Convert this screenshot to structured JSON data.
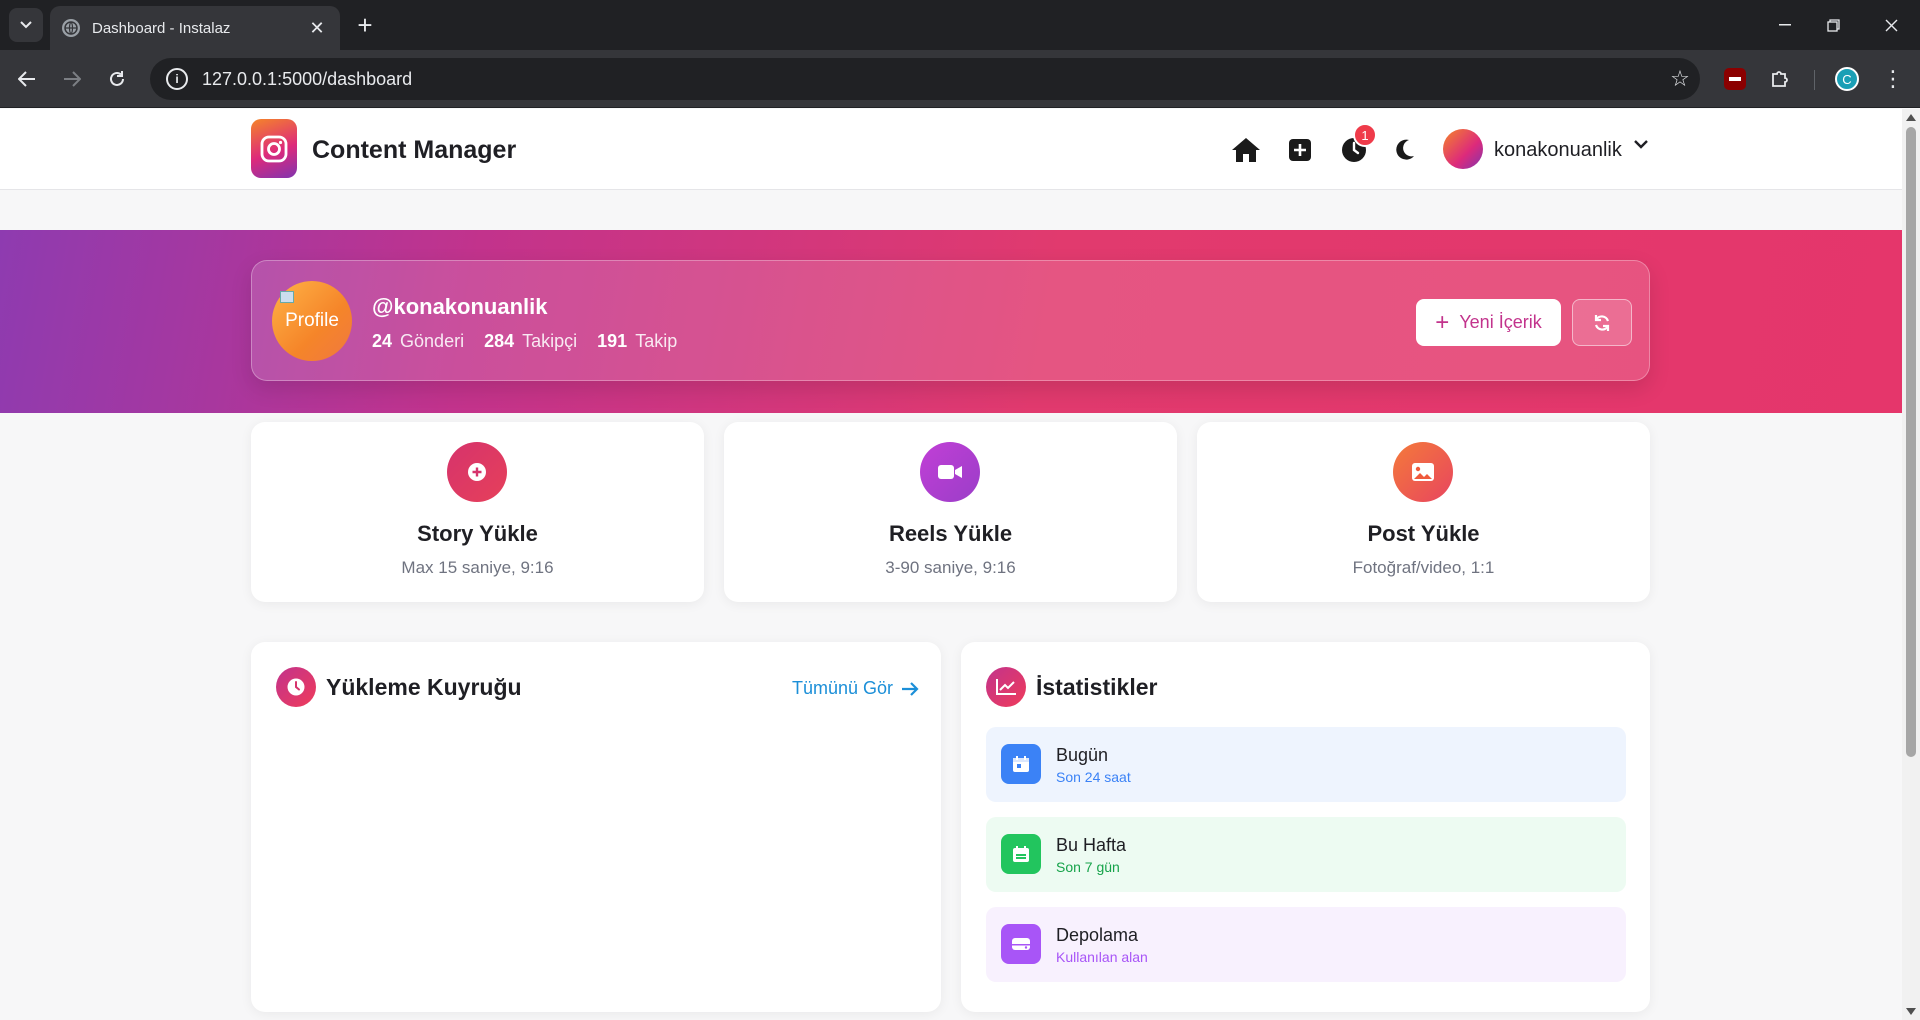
{
  "browser": {
    "tab_title": "Dashboard - Instalaz",
    "url": "127.0.0.1:5000/dashboard",
    "profile_initial": "C"
  },
  "nav": {
    "brand": "Content Manager",
    "notification_count": "1",
    "username": "konakonuanlik"
  },
  "profile": {
    "avatar_alt": "Profile",
    "handle": "@konakonuanlik",
    "stats": [
      {
        "value": "24",
        "label": "Gönderi"
      },
      {
        "value": "284",
        "label": "Takipçi"
      },
      {
        "value": "191",
        "label": "Takip"
      }
    ],
    "new_content_label": "Yeni İçerik"
  },
  "upload_cards": [
    {
      "title": "Story Yükle",
      "subtitle": "Max 15 saniye, 9:16",
      "icon": "plus-circle-icon",
      "color": "#d6336c"
    },
    {
      "title": "Reels Yükle",
      "subtitle": "3-90 saniye, 9:16",
      "icon": "video-icon",
      "color": "#b03fd6"
    },
    {
      "title": "Post Yükle",
      "subtitle": "Fotoğraf/video, 1:1",
      "icon": "image-icon",
      "color": "#ef5a3c"
    }
  ],
  "queue": {
    "title": "Yükleme Kuyruğu",
    "see_all": "Tümünü Gör"
  },
  "stats_panel": {
    "title": "İstatistikler",
    "rows": [
      {
        "label": "Bugün",
        "sub": "Son 24 saat",
        "color": "#3b82f6",
        "bg": "#eef4fe"
      },
      {
        "label": "Bu Hafta",
        "sub": "Son 7 gün",
        "color": "#22c55e",
        "bg": "#edfbf2"
      },
      {
        "label": "Depolama",
        "sub": "Kullanılan alan",
        "color": "#a855f7",
        "bg": "#f8f1fe"
      }
    ]
  },
  "colors": {
    "accent": "#dd2a7b",
    "link": "#1c8fd8"
  }
}
